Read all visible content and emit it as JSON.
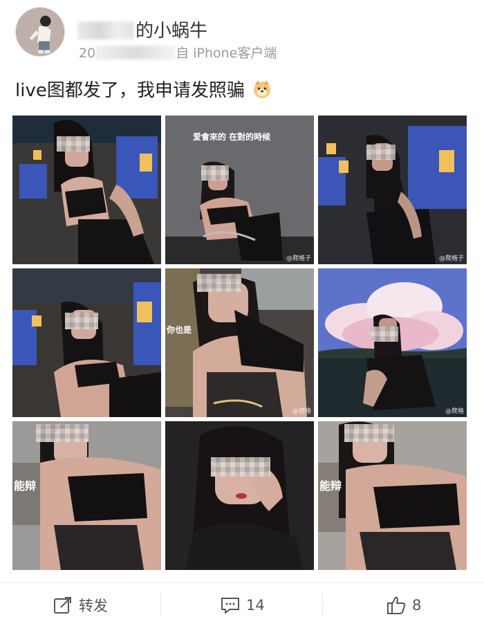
{
  "post": {
    "author_visible_text": "的小蜗牛",
    "date_prefix": "20",
    "source_label": "自 iPhone客户端",
    "text": "live图都发了，我申请发照骗"
  },
  "images": [
    {
      "watermark": "",
      "overlay_text": ""
    },
    {
      "watermark": "@爬格子",
      "overlay_text": "爱會來的 在對的時候"
    },
    {
      "watermark": "@爬格子",
      "overlay_text": ""
    },
    {
      "watermark": "",
      "overlay_text": ""
    },
    {
      "watermark": "@爬格",
      "overlay_text": "你也是"
    },
    {
      "watermark": "@爬格",
      "overlay_text": ""
    },
    {
      "watermark": "",
      "overlay_text": "能辩"
    },
    {
      "watermark": "",
      "overlay_text": ""
    },
    {
      "watermark": "",
      "overlay_text": "能辩"
    }
  ],
  "actions": {
    "repost_label": "转发",
    "comment_count": "14",
    "like_count": "8"
  },
  "icons": {
    "repost": "share-icon",
    "comment": "comment-icon",
    "like": "thumbs-up-icon",
    "emoji": "doge-emoji-icon"
  }
}
